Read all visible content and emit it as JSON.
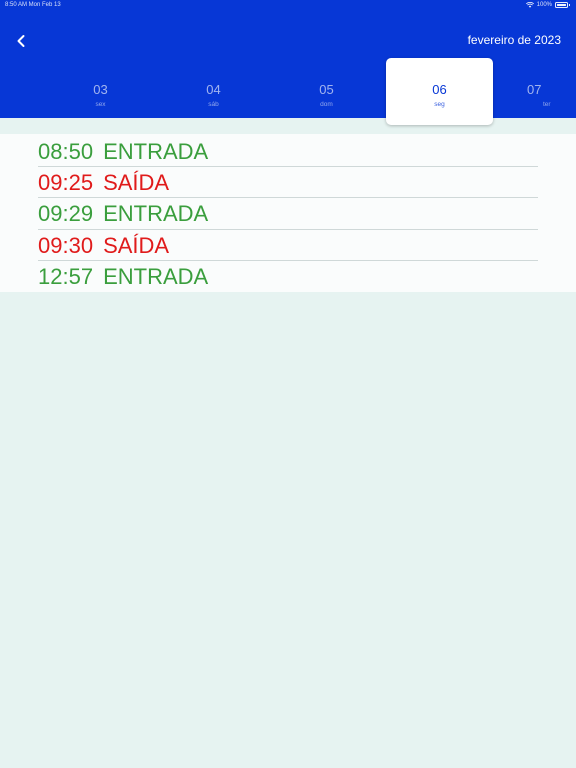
{
  "status_bar": {
    "time_date": "8:50 AM   Mon Feb 13",
    "battery": "100%"
  },
  "header": {
    "back_icon": "chevron-left-icon",
    "month_title": "fevereiro de 2023"
  },
  "days": [
    {
      "num": "03",
      "weekday": "sex",
      "selected": false
    },
    {
      "num": "04",
      "weekday": "sáb",
      "selected": false
    },
    {
      "num": "05",
      "weekday": "dom",
      "selected": false
    },
    {
      "num": "06",
      "weekday": "seg",
      "selected": true
    },
    {
      "num": "07",
      "weekday": "ter",
      "selected": false
    }
  ],
  "entries": [
    {
      "time": "08:50",
      "type": "ENTRADA"
    },
    {
      "time": "09:25",
      "type": "SAÍDA"
    },
    {
      "time": "09:29",
      "type": "ENTRADA"
    },
    {
      "time": "09:30",
      "type": "SAÍDA"
    },
    {
      "time": "12:57",
      "type": "ENTRADA"
    }
  ],
  "colors": {
    "header_bg": "#0737d6",
    "entrada": "#3a9e3d",
    "saida": "#e01b1b",
    "page_bg": "#e6f3f1"
  }
}
